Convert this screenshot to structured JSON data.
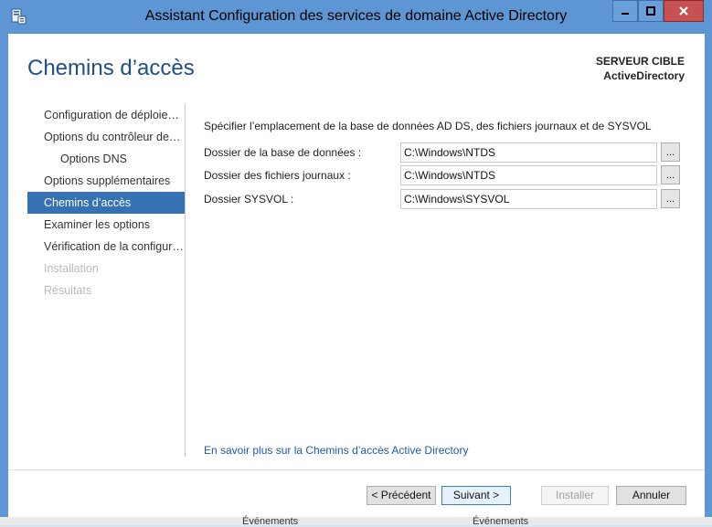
{
  "window": {
    "title": "Assistant Configuration des services de domaine Active Directory",
    "icons": {
      "app": "server-wizard-icon",
      "minimize": "minimize-icon",
      "maximize": "maximize-icon",
      "close": "close-icon"
    },
    "colors": {
      "frame": "#5e95d3",
      "close": "#c75050",
      "accent": "#3671b3",
      "title_text": "#1e4f8a"
    }
  },
  "header": {
    "title": "Chemins d’accès",
    "target_label": "SERVEUR CIBLE",
    "target_name": "ActiveDirectory"
  },
  "nav": {
    "items": [
      {
        "label": "Configuration de déploie…",
        "state": "normal"
      },
      {
        "label": "Options du contrôleur de…",
        "state": "normal"
      },
      {
        "label": "Options DNS",
        "state": "normal"
      },
      {
        "label": "Options supplémentaires",
        "state": "normal"
      },
      {
        "label": "Chemins d’accès",
        "state": "active"
      },
      {
        "label": "Examiner les options",
        "state": "normal"
      },
      {
        "label": "Vérification de la configur…",
        "state": "normal"
      },
      {
        "label": "Installation",
        "state": "disabled"
      },
      {
        "label": "Résultats",
        "state": "disabled"
      }
    ]
  },
  "content": {
    "description": "Spécifier l’emplacement de la base de données AD DS, des fichiers journaux et de SYSVOL",
    "fields": [
      {
        "label": "Dossier de la base de données :",
        "value": "C:\\Windows\\NTDS",
        "browse": "..."
      },
      {
        "label": "Dossier des fichiers journaux :",
        "value": "C:\\Windows\\NTDS",
        "browse": "..."
      },
      {
        "label": "Dossier SYSVOL :",
        "value": "C:\\Windows\\SYSVOL",
        "browse": "..."
      }
    ],
    "learn_more": "En savoir plus sur la Chemins d’accès Active Directory"
  },
  "footer": {
    "previous": "< Précédent",
    "next": "Suivant >",
    "install": "Installer",
    "cancel": "Annuler"
  },
  "background": {
    "left_text": "Événements",
    "right_text": "Événements"
  }
}
